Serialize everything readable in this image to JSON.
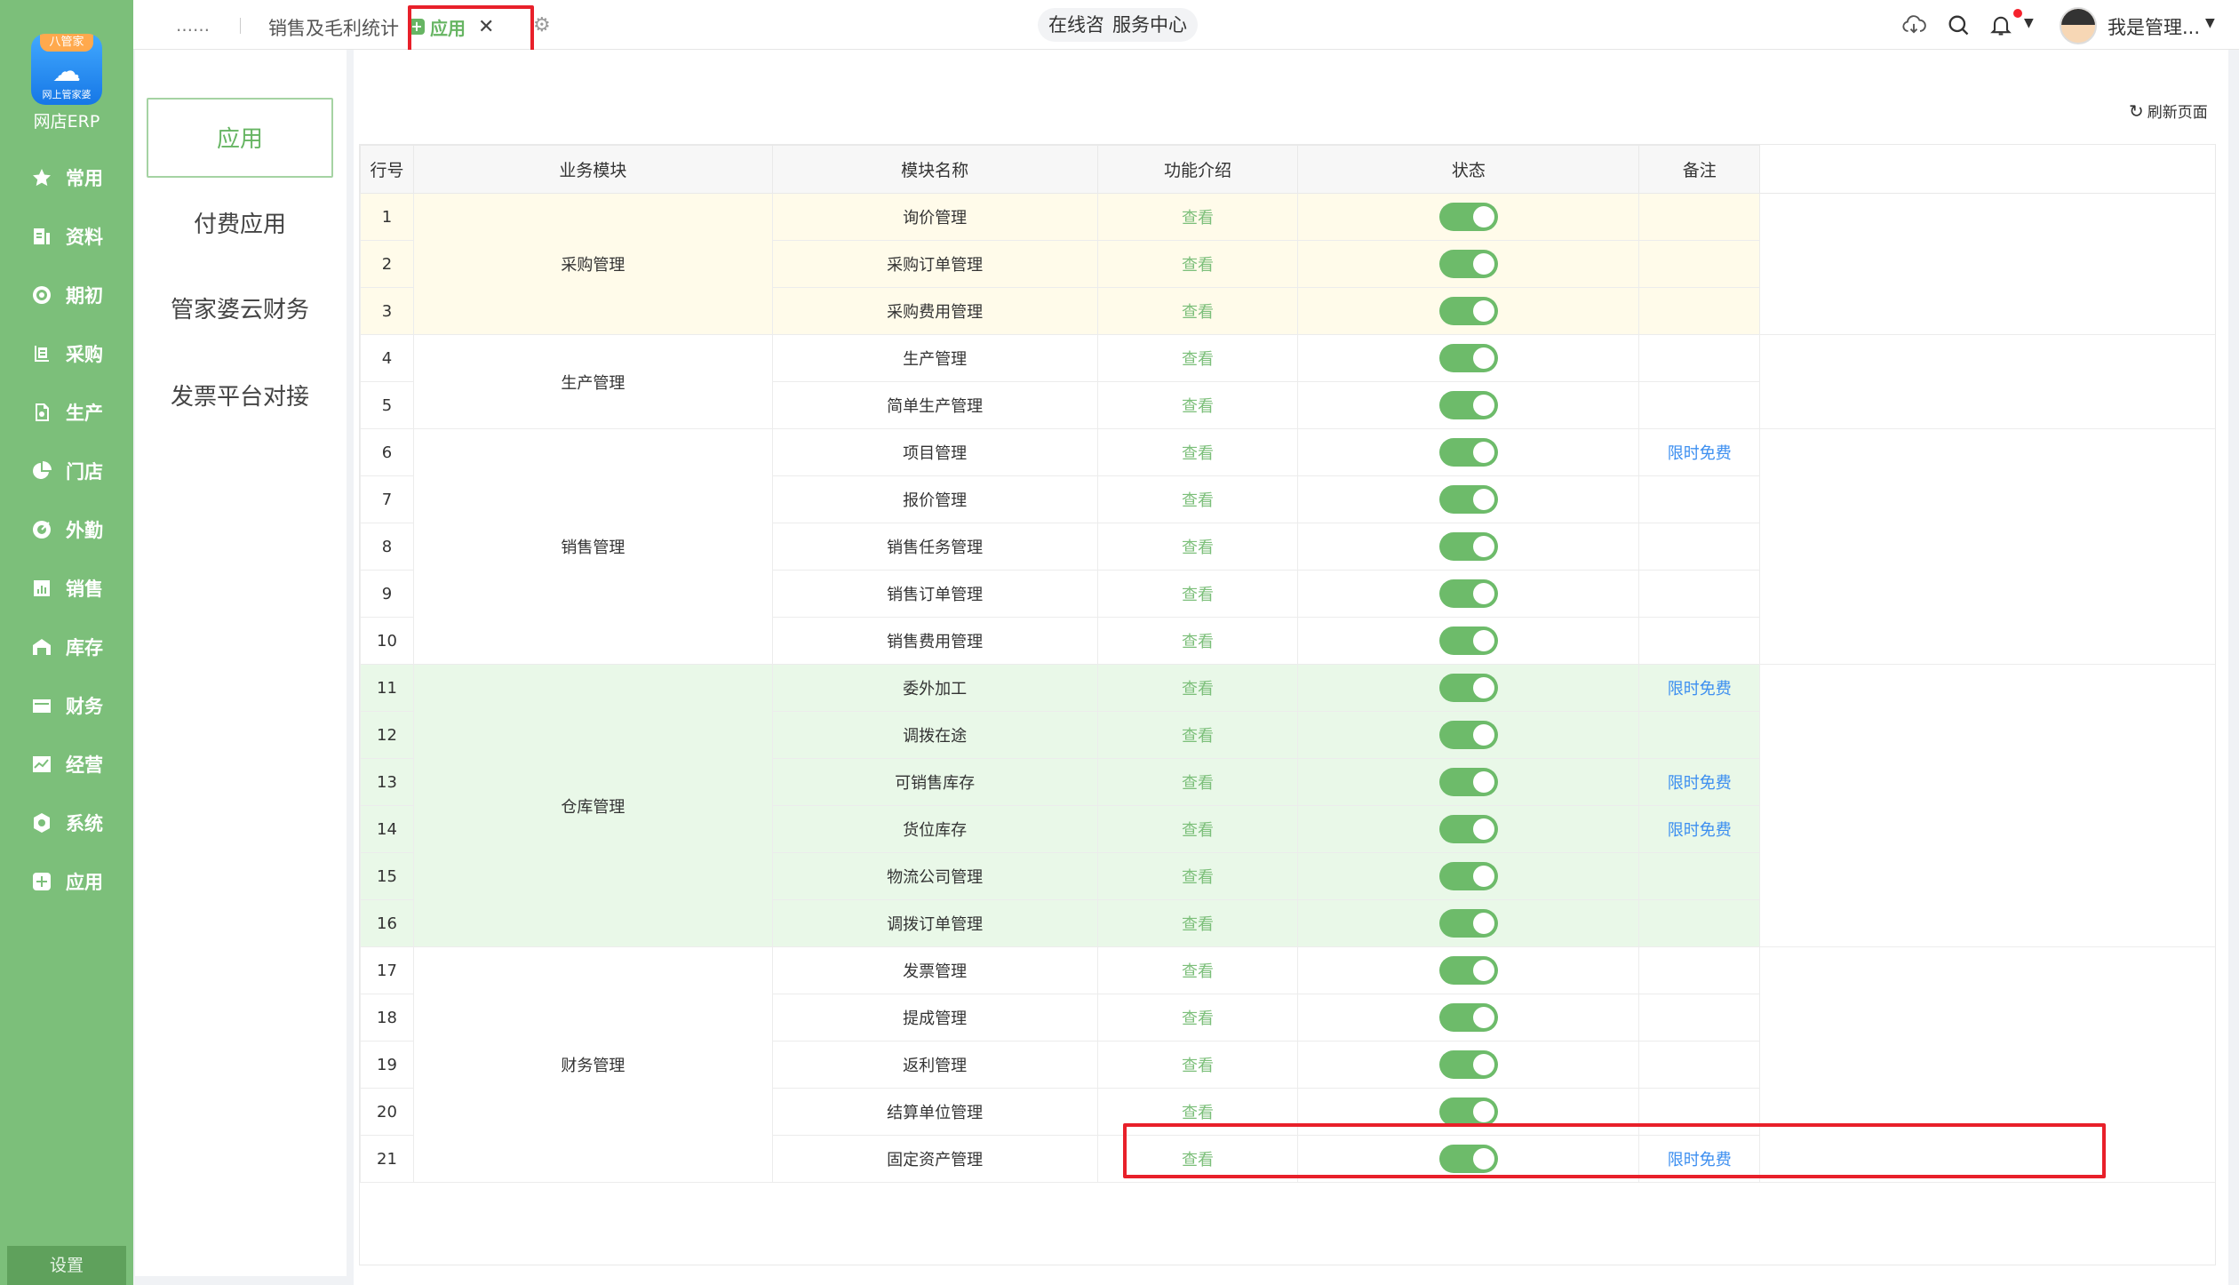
{
  "logo": {
    "ribbon": "八管家",
    "sub": "网上管家婆",
    "brand": "网店ERP"
  },
  "sidebar": {
    "items": [
      {
        "label": "常用",
        "icon": "star-icon"
      },
      {
        "label": "资料",
        "icon": "document-icon"
      },
      {
        "label": "期初",
        "icon": "target-icon"
      },
      {
        "label": "采购",
        "icon": "purchase-icon"
      },
      {
        "label": "生产",
        "icon": "production-icon"
      },
      {
        "label": "门店",
        "icon": "pie-icon"
      },
      {
        "label": "外勤",
        "icon": "field-icon"
      },
      {
        "label": "销售",
        "icon": "chart-icon"
      },
      {
        "label": "库存",
        "icon": "warehouse-icon"
      },
      {
        "label": "财务",
        "icon": "wallet-icon"
      },
      {
        "label": "经营",
        "icon": "trend-icon"
      },
      {
        "label": "系统",
        "icon": "gear-icon"
      },
      {
        "label": "应用",
        "icon": "plus-square-icon"
      }
    ],
    "settings": "设置"
  },
  "topbar": {
    "tab_more": "……",
    "tab_sales": "销售及毛利统计",
    "tab_active": "应用",
    "consult": "在线咨询",
    "service": "服务中心",
    "user": "我是管理..."
  },
  "left_menu": {
    "items": [
      "应用",
      "付费应用",
      "管家婆云财务",
      "发票平台对接"
    ]
  },
  "refresh_label": "刷新页面",
  "table": {
    "headers": [
      "行号",
      "业务模块",
      "模块名称",
      "功能介绍",
      "状态",
      "备注"
    ],
    "view_label": "查看",
    "free_label": "限时免费",
    "groups": [
      {
        "name": "采购管理",
        "theme": "yellow",
        "rows": [
          {
            "no": "1",
            "name": "询价管理",
            "enabled": true,
            "note": ""
          },
          {
            "no": "2",
            "name": "采购订单管理",
            "enabled": true,
            "note": ""
          },
          {
            "no": "3",
            "name": "采购费用管理",
            "enabled": true,
            "note": ""
          }
        ]
      },
      {
        "name": "生产管理",
        "theme": "white",
        "rows": [
          {
            "no": "4",
            "name": "生产管理",
            "enabled": true,
            "note": ""
          },
          {
            "no": "5",
            "name": "简单生产管理",
            "enabled": true,
            "note": ""
          }
        ]
      },
      {
        "name": "销售管理",
        "theme": "white",
        "rows": [
          {
            "no": "6",
            "name": "项目管理",
            "enabled": true,
            "note": "限时免费"
          },
          {
            "no": "7",
            "name": "报价管理",
            "enabled": true,
            "note": ""
          },
          {
            "no": "8",
            "name": "销售任务管理",
            "enabled": true,
            "note": ""
          },
          {
            "no": "9",
            "name": "销售订单管理",
            "enabled": true,
            "note": ""
          },
          {
            "no": "10",
            "name": "销售费用管理",
            "enabled": true,
            "note": ""
          }
        ]
      },
      {
        "name": "仓库管理",
        "theme": "green",
        "rows": [
          {
            "no": "11",
            "name": "委外加工",
            "enabled": true,
            "note": "限时免费"
          },
          {
            "no": "12",
            "name": "调拨在途",
            "enabled": true,
            "note": ""
          },
          {
            "no": "13",
            "name": "可销售库存",
            "enabled": true,
            "note": "限时免费"
          },
          {
            "no": "14",
            "name": "货位库存",
            "enabled": true,
            "note": "限时免费"
          },
          {
            "no": "15",
            "name": "物流公司管理",
            "enabled": true,
            "note": ""
          },
          {
            "no": "16",
            "name": "调拨订单管理",
            "enabled": true,
            "note": ""
          }
        ]
      },
      {
        "name": "财务管理",
        "theme": "white",
        "rows": [
          {
            "no": "17",
            "name": "发票管理",
            "enabled": true,
            "note": ""
          },
          {
            "no": "18",
            "name": "提成管理",
            "enabled": true,
            "note": ""
          },
          {
            "no": "19",
            "name": "返利管理",
            "enabled": true,
            "note": ""
          },
          {
            "no": "20",
            "name": "结算单位管理",
            "enabled": true,
            "note": ""
          },
          {
            "no": "21",
            "name": "固定资产管理",
            "enabled": true,
            "note": "限时免费"
          }
        ]
      }
    ]
  },
  "colors": {
    "primary_green": "#7cbf7a",
    "accent_green": "#67b563",
    "highlight_red": "#e8202a",
    "link_blue": "#3d8ff0"
  }
}
